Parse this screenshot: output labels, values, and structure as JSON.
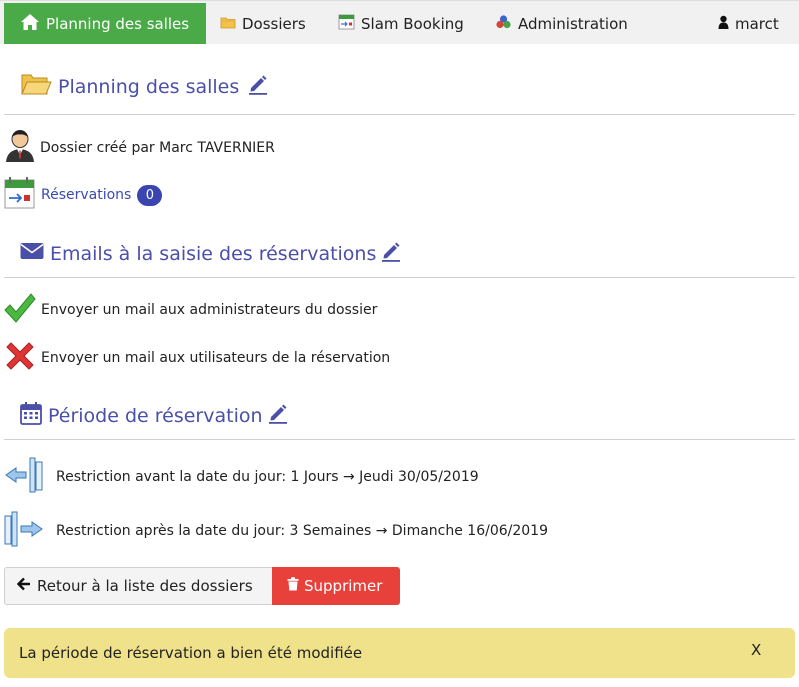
{
  "nav": {
    "home_label": "Planning des salles",
    "dossiers_label": "Dossiers",
    "slam_label": "Slam Booking",
    "admin_label": "Administration",
    "user_label": "marct"
  },
  "folder": {
    "title": "Planning des salles",
    "created_by": "Dossier créé par Marc TAVERNIER",
    "reservations_label": "Réservations",
    "reservations_count": "0"
  },
  "emails": {
    "title": "Emails à la saisie des réservations",
    "admin_mail": "Envoyer un mail aux administrateurs du dossier",
    "users_mail": "Envoyer un mail aux utilisateurs de la réservation"
  },
  "period": {
    "title": "Période de réservation",
    "before": "Restriction avant la date du jour: 1 Jours → Jeudi 30/05/2019",
    "after": "Restriction après la date du jour: 3 Semaines → Dimanche 16/06/2019"
  },
  "actions": {
    "back_label": "Retour à la liste des dossiers",
    "delete_label": "Supprimer"
  },
  "alert": {
    "message": "La période de réservation a bien été modifiée",
    "close": "X"
  },
  "colors": {
    "nav_active": "#4aaa48",
    "heading": "#4a4fa8",
    "badge": "#3a45b0",
    "delete": "#e8413b",
    "alert_bg": "#efe28a"
  }
}
